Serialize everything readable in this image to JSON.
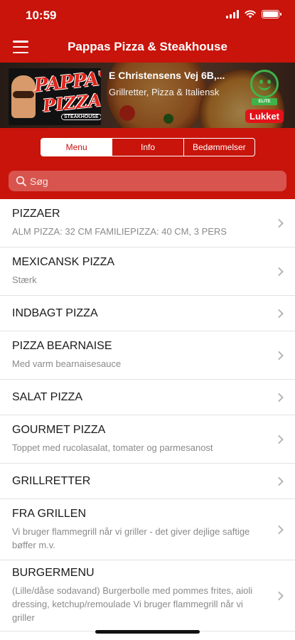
{
  "status_bar": {
    "time": "10:59"
  },
  "nav": {
    "title": "Pappas Pizza & Steakhouse"
  },
  "restaurant": {
    "logo_text_1": "PAPPA'S",
    "logo_text_2": "PIZZA",
    "logo_sub": "STEAKHOUSE",
    "address": "E Christensens Vej 6B,...",
    "cuisine": "Grillretter, Pizza & Italiensk",
    "smiley_label": "ELITE",
    "status": "Lukket",
    "colors": {
      "brand": "#c8140b",
      "smiley": "#3fb34a",
      "closed": "#e3121a"
    }
  },
  "tabs": [
    {
      "label": "Menu",
      "active": true
    },
    {
      "label": "Info",
      "active": false
    },
    {
      "label": "Bedømmelser",
      "active": false
    }
  ],
  "search": {
    "placeholder": "Søg",
    "value": ""
  },
  "menu": [
    {
      "title": "PIZZAER",
      "desc": "ALM PIZZA: 32 CM  FAMILIEPIZZA: 40 CM, 3 PERS"
    },
    {
      "title": "MEXICANSK PIZZA",
      "desc": "Stærk"
    },
    {
      "title": "INDBAGT PIZZA",
      "desc": ""
    },
    {
      "title": "PIZZA BEARNAISE",
      "desc": "Med varm bearnaisesauce"
    },
    {
      "title": "SALAT PIZZA",
      "desc": ""
    },
    {
      "title": "GOURMET PIZZA",
      "desc": "Toppet med rucolasalat, tomater og parmesanost"
    },
    {
      "title": "GRILLRETTER",
      "desc": ""
    },
    {
      "title": "FRA GRILLEN",
      "desc": "Vi bruger flammegrill når vi griller - det giver dejlige saftige bøffer m.v."
    },
    {
      "title": "BURGERMENU",
      "desc": "(Lille/dåse sodavand) Burgerbolle med pommes frites, aioli dressing, ketchup/remoulade Vi bruger flammegrill når vi griller"
    }
  ]
}
